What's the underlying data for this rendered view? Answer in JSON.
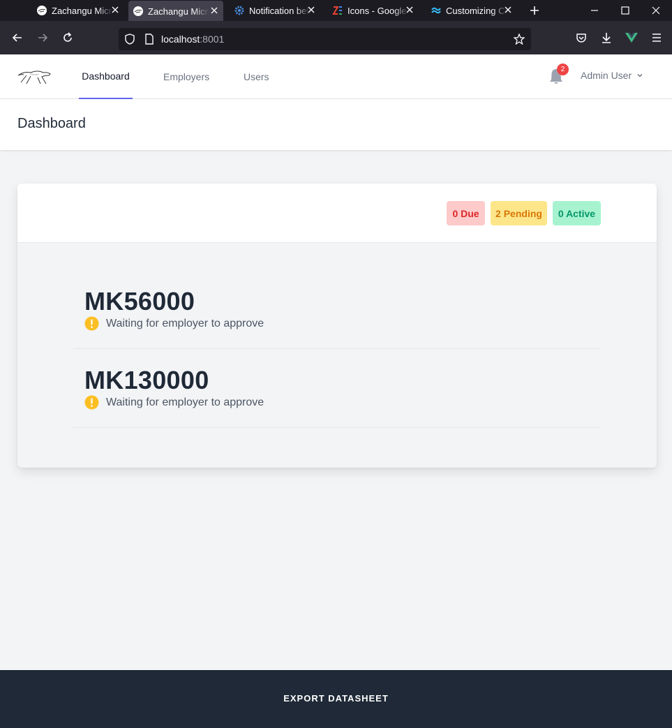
{
  "browser": {
    "tabs": [
      {
        "title": "Zachangu Micro",
        "icon": "cheetah-favicon",
        "active": false
      },
      {
        "title": "Zachangu Micro",
        "icon": "cheetah-favicon",
        "active": true
      },
      {
        "title": "Notification bell",
        "icon": "gear-favicon",
        "active": false
      },
      {
        "title": "Icons - Google F",
        "icon": "google-fonts-favicon",
        "active": false
      },
      {
        "title": "Customizing Co",
        "icon": "tailwind-favicon",
        "active": false
      }
    ],
    "url_host": "localhost",
    "url_port": ":8001"
  },
  "header": {
    "nav": [
      {
        "label": "Dashboard",
        "active": true
      },
      {
        "label": "Employers",
        "active": false
      },
      {
        "label": "Users",
        "active": false
      }
    ],
    "notification_count": "2",
    "user_name": "Admin User"
  },
  "page": {
    "title": "Dashboard"
  },
  "summary": {
    "due": "0 Due",
    "pending": "2 Pending",
    "active": "0 Active"
  },
  "loans": [
    {
      "amount": "MK56000",
      "status": "Waiting for employer to approve"
    },
    {
      "amount": "MK130000",
      "status": "Waiting for employer to approve"
    }
  ],
  "footer": {
    "export_label": "EXPORT DATASHEET"
  },
  "colors": {
    "accent": "#6366f1",
    "due": "#dc2626",
    "pending": "#d97706",
    "active": "#059669",
    "warning": "#fbbf24"
  }
}
